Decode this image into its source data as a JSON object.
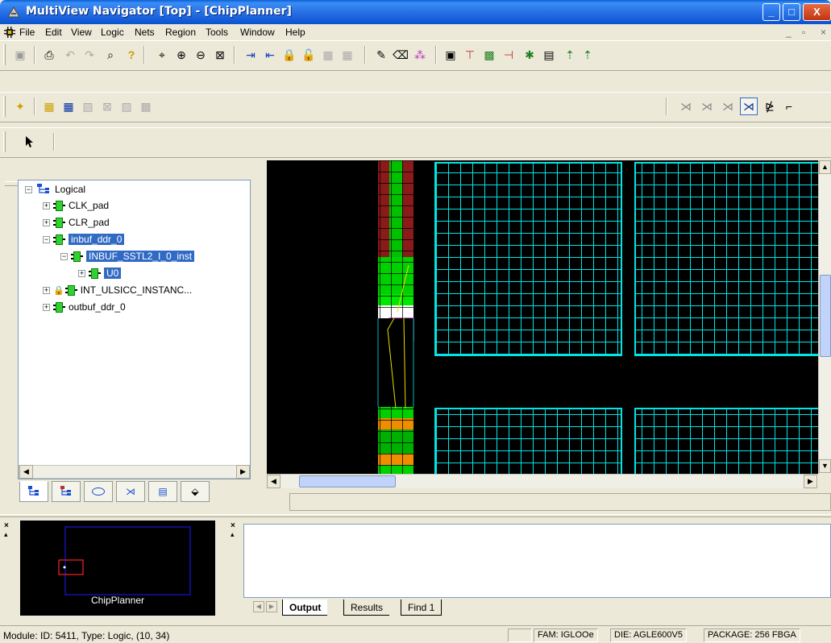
{
  "window": {
    "title": "MultiView Navigator [Top] - [ChipPlanner]",
    "controls": {
      "minimize": "_",
      "maximize": "□",
      "close": "X"
    }
  },
  "menu": {
    "items": [
      "File",
      "Edit",
      "View",
      "Logic",
      "Nets",
      "Region",
      "Tools",
      "Window",
      "Help"
    ],
    "doc_controls": [
      "_",
      "▫",
      "×"
    ]
  },
  "tree": {
    "root": "Logical",
    "nodes": [
      {
        "label": "CLK_pad"
      },
      {
        "label": "CLR_pad"
      },
      {
        "label": "inbuf_ddr_0"
      },
      {
        "label": "INBUF_SSTL2_I_0_inst"
      },
      {
        "label": "U0"
      },
      {
        "label": "INT_ULSICC_INSTANC..."
      },
      {
        "label": "outbuf_ddr_0"
      }
    ]
  },
  "minimap": {
    "label": "ChipPlanner"
  },
  "output": {
    "tabs": [
      "Output",
      "Results",
      "Find 1"
    ],
    "active_tab": "Output"
  },
  "status": {
    "message": "Module: ID: 5411, Type: Logic, (10, 34)",
    "family": "FAM: IGLOOe",
    "die": "DIE: AGLE600V5",
    "package": "PACKAGE: 256 FBGA"
  },
  "colors": {
    "grid": "#00e5e5",
    "title_bar": "#0b52d0",
    "selection": "#316ac5",
    "green": "#00d000",
    "dark_red": "#8b1a1a",
    "orange": "#f08c00"
  }
}
